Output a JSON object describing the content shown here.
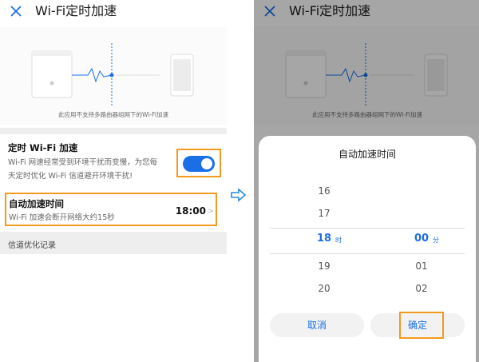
{
  "app": {
    "title": "Wi-Fi定时加速"
  },
  "hero": {
    "caption": "此应用不支持多路由器组网下的Wi-Fi加速"
  },
  "scheduled": {
    "title": "定时 Wi-Fi 加速",
    "desc_line1": "Wi-Fi 网速经常受到环境干扰而变慢，为您每",
    "desc_line2": "天定时优化 Wi-Fi 信道避开环境干扰!",
    "enabled": true
  },
  "auto_time": {
    "title": "自动加速时间",
    "desc": "Wi-Fi 加速会断开网络大约15秒",
    "value": "18:00",
    "chevron": ">"
  },
  "history": {
    "label": "信道优化记录"
  },
  "dialog": {
    "title": "自动加速时间",
    "hours": [
      "16",
      "17",
      "18",
      "19",
      "20"
    ],
    "minutes": [
      "",
      "",
      "00",
      "01",
      "02"
    ],
    "hour_unit": "时",
    "minute_unit": "分",
    "cancel": "取消",
    "confirm": "确定"
  },
  "colors": {
    "accent": "#1a6fe6",
    "highlight": "#f39a1e"
  }
}
